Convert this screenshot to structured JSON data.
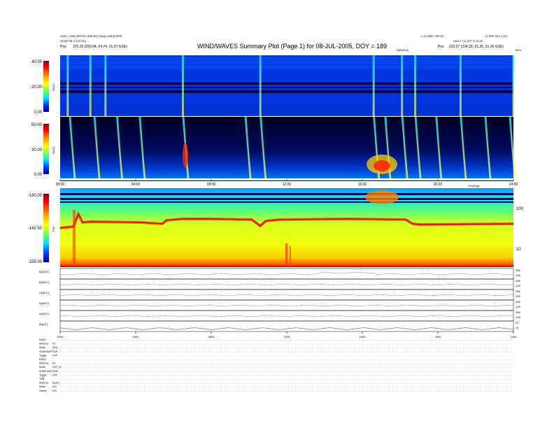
{
  "header": {
    "title": "WIND/WAVES Summary Plot (Page 1) for 08-JUL-2005, DOY = 189",
    "left_line1": "4000-> 2000 BPOSS (RB090) Yearly: ANE(F)EPE",
    "left_line2": "AE@PSB 2.3 50.001",
    "left_line3_label": "Pos",
    "left_line3_value": "225.26 (233.04, 24.74, 31.37 GSE)",
    "right_line1": "LLRRFOKT.4.x01",
    "center_right_line1": "1.10 WBO 35P/03",
    "right_line2": "DAILY TU 23 P G 20.05",
    "right_line3_label": "Pos",
    "right_line3_value": "223.07 (234.23, 21.30, 31.26 GSE)",
    "tnr_top_label": "TNR(KHz)",
    "mhz_label": "MHz"
  },
  "panels": {
    "rad2": {
      "name": "RAD2",
      "ticks": [
        "40.00",
        "20.00",
        "0.00"
      ]
    },
    "rad1": {
      "name": "RAD1",
      "ticks": [
        "50.00",
        "30.00",
        "0.00"
      ]
    },
    "tnr": {
      "name": "TNR",
      "ticks": [
        "-130.00",
        "-142.50",
        "-155.00"
      ],
      "right_ticks": [
        "100",
        "10"
      ],
      "right_top_label": "KHz(log)"
    }
  },
  "time_axis": [
    "00:00",
    "04:00",
    "08:00",
    "12:00",
    "16:00",
    "20:00",
    "24:00"
  ],
  "bottom_axis": [
    "0000",
    "0400",
    "0800",
    "1200",
    "1600",
    "2000",
    "2400"
  ],
  "strips": [
    {
      "label": "B(ADC)",
      "right": [
        "256",
        "128"
      ]
    },
    {
      "label": "B(ADC)",
      "right": [
        "256",
        "128"
      ]
    },
    {
      "label": "C(ADC)",
      "right": [
        "256",
        "128"
      ]
    },
    {
      "label": "N(ADC)",
      "right": [
        "256",
        "128"
      ]
    },
    {
      "label": "A(ADC)",
      "right": [
        "256",
        "128"
      ]
    },
    {
      "label": "|B|(nT)",
      "right": [
        "20",
        "10"
      ]
    }
  ],
  "info_block": [
    {
      "label": "RAD2",
      "value": ""
    },
    {
      "label": "Antenna",
      "value": "Sx"
    },
    {
      "label": "Mode",
      "value": "SEQ"
    },
    {
      "label": "SUMCHAP",
      "value": "SUP"
    },
    {
      "label": "Toggle",
      "value": "OFF"
    },
    {
      "label": "RAD1",
      "value": ""
    },
    {
      "label": "Antenna",
      "value": "Sx"
    },
    {
      "label": "Mode",
      "value": "LIST_A"
    },
    {
      "label": "SUMCHAP",
      "value": "SUM"
    },
    {
      "label": "Toggle",
      "value": "OFF"
    },
    {
      "label": "TNR",
      "value": ""
    },
    {
      "label": "Antenna",
      "value": "Ey/Ey"
    },
    {
      "label": "Mode",
      "value": "A,B"
    },
    {
      "label": "Sweep",
      "value": "A,B,"
    }
  ],
  "chart_data": [
    {
      "type": "heatmap",
      "title": "RAD2",
      "x_range": [
        "00:00",
        "24:00"
      ],
      "colorbar_ticks": [
        40.0,
        20.0,
        0.0
      ],
      "colormap": "jet",
      "bursts_hours": [
        0.4,
        1.6,
        2.4,
        6.5,
        10.6,
        16.6,
        18.1,
        18.8,
        21.2,
        24.0
      ]
    },
    {
      "type": "heatmap",
      "title": "RAD1",
      "x_range": [
        "00:00",
        "24:00"
      ],
      "colorbar_ticks": [
        50.0,
        30.0,
        0.0
      ],
      "colormap": "jet",
      "bursts_hours": [
        0.5,
        1.8,
        3.0,
        4.2,
        6.5,
        9.8,
        10.6,
        16.6,
        17.2,
        18.1,
        18.8,
        19.9,
        21.2,
        22.5,
        23.8
      ]
    },
    {
      "type": "heatmap",
      "title": "TNR",
      "x_range": [
        "00:00",
        "24:00"
      ],
      "colorbar_ticks": [
        -130.0,
        -142.5,
        -155.0
      ],
      "colormap": "jet",
      "y_scale": "log",
      "yticks_right": [
        100,
        10
      ]
    }
  ],
  "colors": {
    "cbar_top": "#8a0000",
    "cbar_mid": "#ffff00",
    "cbar_bottom": "#00008a"
  }
}
